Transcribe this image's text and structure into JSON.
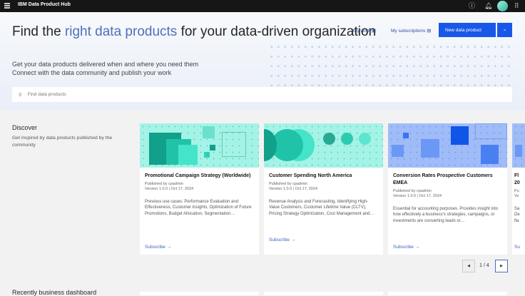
{
  "header": {
    "title": "IBM Data Product Hub"
  },
  "hero": {
    "title_pre": "Find the ",
    "title_highlight": "right data products",
    "title_post": " for your data-driven organization",
    "line1": "Get your data products delivered when and where you need them",
    "line2": "Connect with the data community and publish your work",
    "my_work": "My work",
    "my_subscriptions": "My subscriptions",
    "new_data_product": "New data product"
  },
  "search": {
    "placeholder": "Find data products"
  },
  "discover": {
    "title": "Discover",
    "subtitle": "Get inspired by data products published by the community",
    "cards": [
      {
        "title": "Promotional Campaign Strategy (Worldwide)",
        "published": "Published by cpadmin",
        "version": "Version 1.0.0 | Oct 17, 2024",
        "description": "Previous use cases: Performance Evaluation and Effectiveness, Customer Insights, Optimization of Future Promotions, Budget Allocation, Segmentation…",
        "action": "Subscribe →"
      },
      {
        "title": "Customer Spending North America",
        "published": "Published by cpadmin",
        "version": "Version 1.0.0 | Oct 17, 2024",
        "description": "Revenue Analysis and Forecasting, Identifying High-Value Customers, Customer Lifetime Value (CLTV), Pricing Strategy Optimization, Cost Management and…",
        "action": "Subscribe →"
      },
      {
        "title": "Conversion Rates Prospective Customers EMEA",
        "published": "Published by cpadmin",
        "version": "Version 1.0.0 | Oct 17, 2024",
        "description": "Essential for accounting purposes. Provides insight into how effectively a business's strategies, campaigns, or investments are converting leads or…",
        "action": "Subscribe →"
      },
      {
        "title": "Fl 20",
        "published": "Pu",
        "version": "Ve",
        "description": "Sa De fla",
        "action": "Su"
      }
    ],
    "pagination": "1 / 4"
  },
  "section2": {
    "title": "Recently business dashboard"
  }
}
